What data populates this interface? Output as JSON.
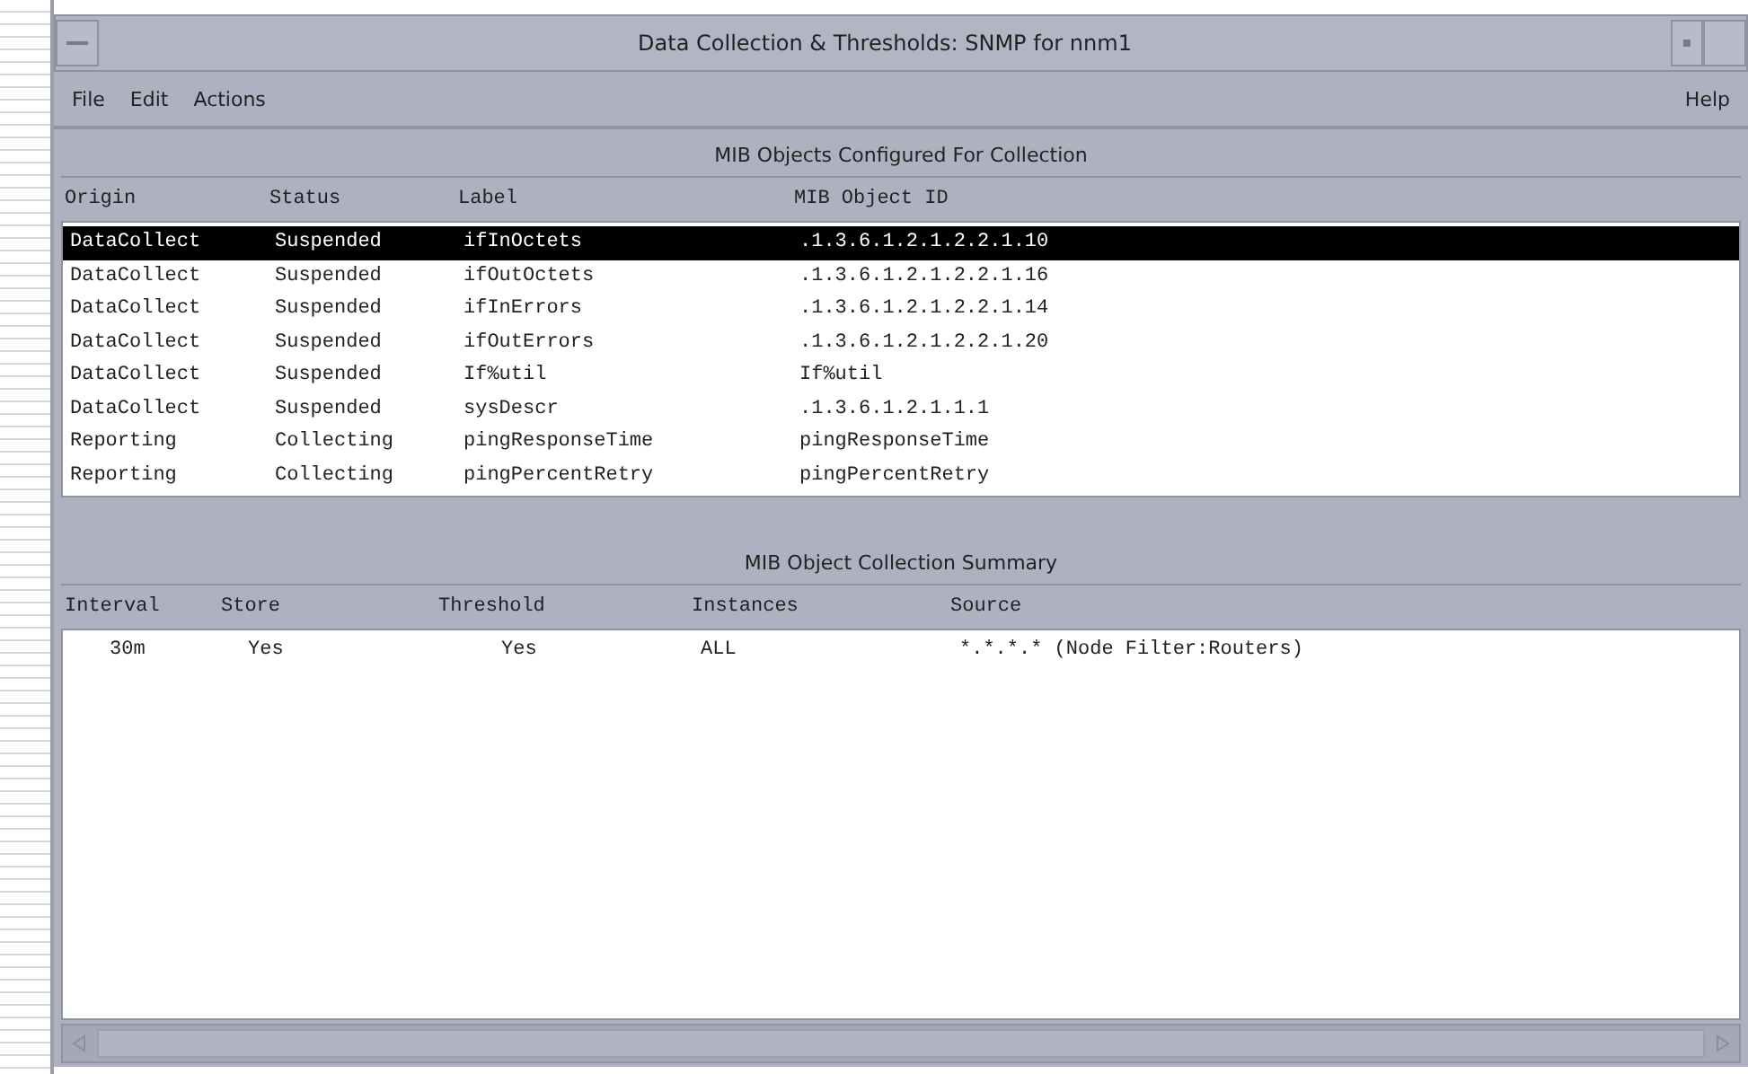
{
  "window": {
    "title": "Data Collection & Thresholds: SNMP for nnm1"
  },
  "menu": {
    "left": [
      "File",
      "Edit",
      "Actions"
    ],
    "right": [
      "Help"
    ]
  },
  "configured": {
    "title": "MIB Objects Configured For Collection",
    "columns": [
      "Origin",
      "Status",
      "Label",
      "MIB Object ID"
    ],
    "rows": [
      {
        "cells": [
          "DataCollect",
          "Suspended",
          "ifInOctets",
          ".1.3.6.1.2.1.2.2.1.10"
        ],
        "selected": true
      },
      {
        "cells": [
          "DataCollect",
          "Suspended",
          "ifOutOctets",
          ".1.3.6.1.2.1.2.2.1.16"
        ],
        "selected": false
      },
      {
        "cells": [
          "DataCollect",
          "Suspended",
          "ifInErrors",
          ".1.3.6.1.2.1.2.2.1.14"
        ],
        "selected": false
      },
      {
        "cells": [
          "DataCollect",
          "Suspended",
          "ifOutErrors",
          ".1.3.6.1.2.1.2.2.1.20"
        ],
        "selected": false
      },
      {
        "cells": [
          "DataCollect",
          "Suspended",
          "If%util",
          "If%util"
        ],
        "selected": false
      },
      {
        "cells": [
          "DataCollect",
          "Suspended",
          "sysDescr",
          ".1.3.6.1.2.1.1.1"
        ],
        "selected": false
      },
      {
        "cells": [
          "Reporting",
          "Collecting",
          "pingResponseTime",
          "pingResponseTime"
        ],
        "selected": false
      },
      {
        "cells": [
          "Reporting",
          "Collecting",
          "pingPercentRetry",
          "pingPercentRetry"
        ],
        "selected": false
      }
    ]
  },
  "summary": {
    "title": "MIB Object Collection Summary",
    "columns": [
      "Interval",
      "Store",
      "Threshold",
      "Instances",
      "Source"
    ],
    "rows": [
      {
        "cells": [
          "30m",
          "Yes",
          "Yes",
          "ALL",
          "*.*.*.* (Node Filter:Routers)"
        ]
      }
    ]
  }
}
